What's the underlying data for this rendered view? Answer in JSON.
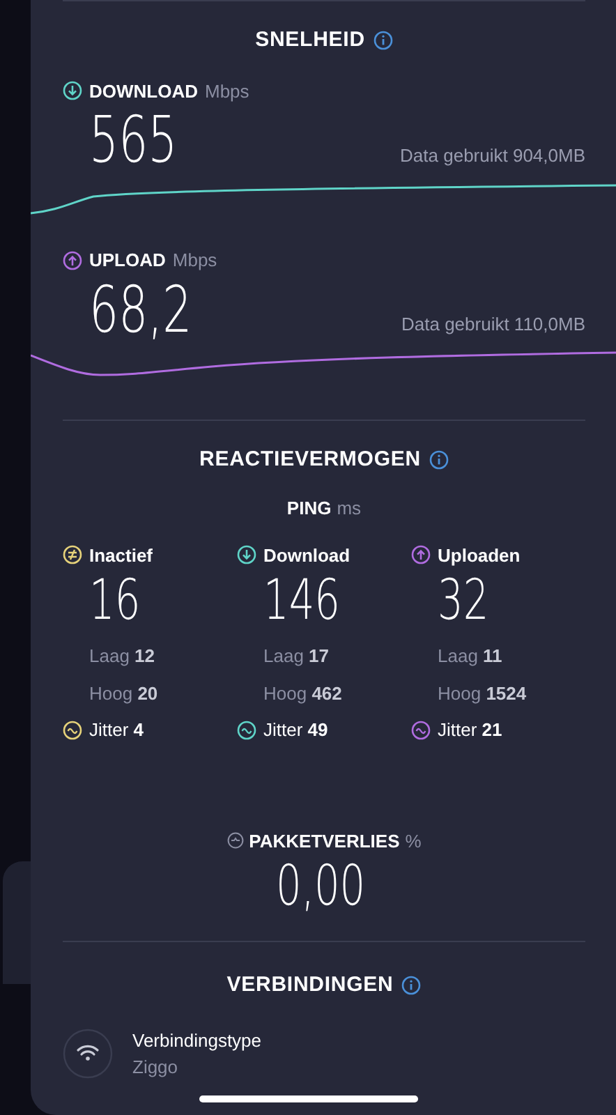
{
  "speed": {
    "title": "SNELHEID",
    "metrics": [
      {
        "kind": "download",
        "label": "DOWNLOAD",
        "unit": "Mbps",
        "value": "565",
        "data_used": "Data gebruikt 904,0MB"
      },
      {
        "kind": "upload",
        "label": "UPLOAD",
        "unit": "Mbps",
        "value": "68,2",
        "data_used": "Data gebruikt 110,0MB"
      }
    ]
  },
  "responsiveness": {
    "title": "REACTIEVERMOGEN",
    "ping_label": "PING",
    "ping_unit": "ms",
    "columns": [
      {
        "kind": "idle",
        "label": "Inactief",
        "value": "16",
        "low_label": "Laag",
        "low": "12",
        "high_label": "Hoog",
        "high": "20",
        "jitter_label": "Jitter",
        "jitter": "4",
        "color": "#e6d27a"
      },
      {
        "kind": "download",
        "label": "Download",
        "value": "146",
        "low_label": "Laag",
        "low": "17",
        "high_label": "Hoog",
        "high": "462",
        "jitter_label": "Jitter",
        "jitter": "49",
        "color": "#5fd4c8"
      },
      {
        "kind": "upload",
        "label": "Uploaden",
        "value": "32",
        "low_label": "Laag",
        "low": "11",
        "high_label": "Hoog",
        "high": "1524",
        "jitter_label": "Jitter",
        "jitter": "21",
        "color": "#b06ce0"
      }
    ]
  },
  "packet_loss": {
    "label": "PAKKETVERLIES",
    "unit": "%",
    "value": "0,00"
  },
  "connections": {
    "title": "VERBINDINGEN",
    "items": [
      {
        "kind": "wifi",
        "label": "Verbindingstype",
        "value": "Ziggo"
      }
    ]
  }
}
